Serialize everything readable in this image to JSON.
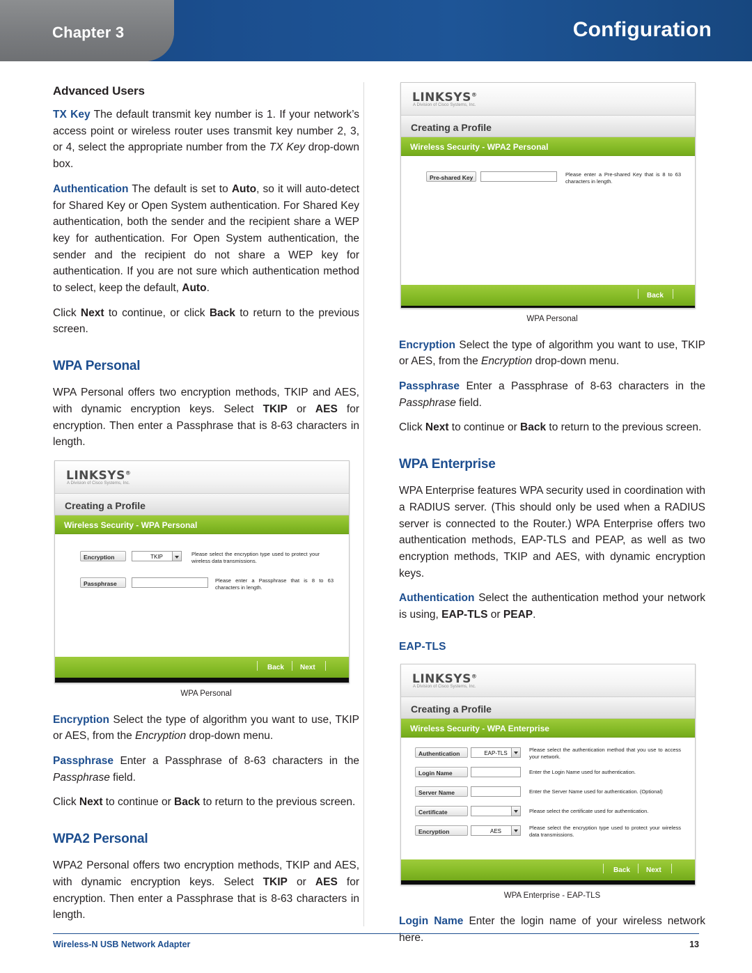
{
  "header": {
    "chapter_label": "Chapter",
    "chapter_number": "3",
    "chapter_full": "Chapter  3",
    "title": "Configuration"
  },
  "left_column": {
    "advanced_users_heading": "Advanced Users",
    "p_txkey_kw": "TX Key",
    "p_txkey_rest": " The default transmit key number is 1. If your network’s access point or wireless router uses transmit key number 2, 3, or 4, select the appropriate number from the ",
    "p_txkey_italic": "TX Key",
    "p_txkey_tail": " drop-down box.",
    "p_auth_kw": "Authentication",
    "p_auth_a": " The default is set to ",
    "p_auth_b": "Auto",
    "p_auth_c": ", so it will auto-detect for Shared Key or Open System authentication. For Shared Key authentication, both the sender and the recipient share a WEP key for authentication. For Open System authentication, the sender and the recipient do not share a WEP key for authentication. If you are not sure which authentication method to select, keep the default, ",
    "p_auth_d": "Auto",
    "p_auth_e": ".",
    "p_click_a": "Click ",
    "p_click_next": "Next",
    "p_click_b": " to continue, or click ",
    "p_click_back": "Back",
    "p_click_c": " to return to the previous screen.",
    "wpa_personal_heading": "WPA Personal",
    "wpa_personal_body_a": "WPA Personal offers two encryption methods, TKIP and AES, with dynamic encryption keys. Select ",
    "wpa_personal_tkip": "TKIP",
    "wpa_personal_or": " or ",
    "wpa_personal_aes": "AES",
    "wpa_personal_body_b": " for encryption. Then enter a Passphrase that is 8-63 characters in length.",
    "caption_wpa_personal": "WPA Personal",
    "p_enc_kw": "Encryption",
    "p_enc_a": "  Select the type of algorithm you want to use, TKIP or AES, from the ",
    "p_enc_italic": "Encryption",
    "p_enc_b": " drop-down menu.",
    "p_pass_kw": "Passphrase",
    "p_pass_a": "  Enter a Passphrase of 8-63 characters in the ",
    "p_pass_italic": "Passphrase",
    "p_pass_b": " field.",
    "p_click2_a": "Click ",
    "p_click2_next": "Next",
    "p_click2_b": " to continue or ",
    "p_click2_back": "Back",
    "p_click2_c": " to return to the previous screen.",
    "wpa2_personal_heading": "WPA2 Personal",
    "wpa2_personal_body_a": "WPA2 Personal offers two encryption methods, TKIP and AES, with dynamic encryption keys. Select ",
    "wpa2_personal_tkip": "TKIP",
    "wpa2_personal_or": " or ",
    "wpa2_personal_aes": "AES",
    "wpa2_personal_body_b": " for encryption. Then enter a Passphrase that is 8-63 characters in length."
  },
  "right_column": {
    "caption_wpa_personal": "WPA Personal",
    "p_enc_kw": "Encryption",
    "p_enc_a": "  Select the type of algorithm you want to use, TKIP or AES, from the ",
    "p_enc_italic": "Encryption",
    "p_enc_b": " drop-down menu.",
    "p_pass_kw": "Passphrase",
    "p_pass_a": "  Enter a Passphrase of 8-63 characters in the ",
    "p_pass_italic": "Passphrase",
    "p_pass_b": " field.",
    "p_click_a": "Click ",
    "p_click_next": "Next",
    "p_click_b": " to continue or ",
    "p_click_back": "Back",
    "p_click_c": " to return to the previous screen.",
    "wpa_enterprise_heading": "WPA Enterprise",
    "wpa_enterprise_body": "WPA Enterprise features WPA security used in coordination with a RADIUS server. (This should only be used when a RADIUS server is connected to the Router.) WPA Enterprise offers two authentication methods, EAP-TLS and PEAP, as well as two encryption methods, TKIP and AES, with dynamic encryption keys.",
    "p_auth_kw": "Authentication",
    "p_auth_a": " Select the authentication method your network is using, ",
    "p_auth_eaptls": "EAP-TLS",
    "p_auth_or": " or ",
    "p_auth_peap": "PEAP",
    "p_auth_b": ".",
    "eap_tls_heading": "EAP-TLS",
    "caption_eaptls": "WPA Enterprise - EAP-TLS",
    "p_login_kw": "Login Name",
    "p_login_body": " Enter the login name of your wireless network here."
  },
  "screens": {
    "wpa2_personal": {
      "logo": "LINKSYS",
      "logo_sup": "®",
      "logo_sub": "A Division of Cisco Systems, Inc.",
      "window_title": "Creating a Profile",
      "section_title": "Wireless Security - WPA2 Personal",
      "fields": [
        {
          "label": "Pre-shared Key",
          "type": "text",
          "value": "",
          "description": "Please enter a Pre-shared Key that is 8 to 63 characters in length."
        }
      ],
      "buttons": [
        "Back"
      ]
    },
    "wpa_personal": {
      "logo": "LINKSYS",
      "logo_sup": "®",
      "logo_sub": "A Division of Cisco Systems, Inc.",
      "window_title": "Creating a Profile",
      "section_title": "Wireless Security - WPA Personal",
      "fields": [
        {
          "label": "Encryption",
          "type": "select",
          "value": "TKIP",
          "description": "Please select the encryption type used to protect your wireless data transmissions."
        },
        {
          "label": "Passphrase",
          "type": "text",
          "value": "",
          "description": "Please enter a Passphrase that is 8 to 63 characters in length."
        }
      ],
      "buttons": [
        "Back",
        "Next"
      ]
    },
    "wpa_enterprise_eaptls": {
      "logo": "LINKSYS",
      "logo_sup": "®",
      "logo_sub": "A Division of Cisco Systems, Inc.",
      "window_title": "Creating a Profile",
      "section_title": "Wireless Security - WPA Enterprise",
      "fields": [
        {
          "label": "Authentication",
          "type": "select",
          "value": "EAP-TLS",
          "description": "Please select the authentication method that you use to access your network."
        },
        {
          "label": "Login Name",
          "type": "text",
          "value": "",
          "description": "Enter the Login Name used for authentication."
        },
        {
          "label": "Server Name",
          "type": "text",
          "value": "",
          "description": "Enter the Server Name used for authentication. (Optional)"
        },
        {
          "label": "Certificate",
          "type": "select",
          "value": "",
          "description": "Please select the certificate used for authentication."
        },
        {
          "label": "Encryption",
          "type": "select",
          "value": "AES",
          "description": "Please select the encryption type used to protect your wireless data transmissions."
        }
      ],
      "buttons": [
        "Back",
        "Next"
      ]
    }
  },
  "footer": {
    "left": "Wireless-N USB Network Adapter",
    "page_number": "13"
  },
  "colors": {
    "brand_blue": "#1d4e8f",
    "accent_green": "#86bb27",
    "chapter_gray": "#7b7d80",
    "text": "#231f20"
  }
}
